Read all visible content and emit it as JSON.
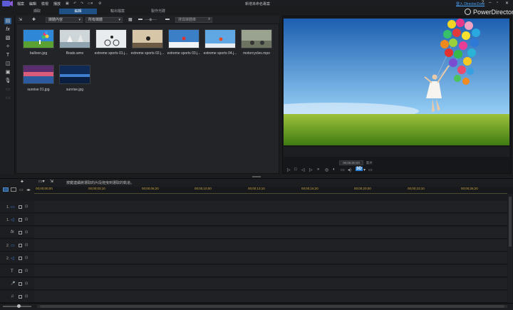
{
  "menu": [
    "檔案",
    "編輯",
    "檢視",
    "播放"
  ],
  "project_title": "新增未命名專案",
  "login_link": "登入 DirectorZone",
  "brand": "PowerDirector",
  "tabs": [
    {
      "label": "擷取"
    },
    {
      "label": "編輯"
    },
    {
      "label": "輸出檔案"
    },
    {
      "label": "製作光碟"
    }
  ],
  "library": {
    "filter1": "媒體內容",
    "filter2": "所有媒體",
    "search_placeholder": "搜尋媒體庫",
    "items": [
      {
        "label": "balloon.jpg"
      },
      {
        "label": "Boats.wmv"
      },
      {
        "label": "extreme sports 01.j..."
      },
      {
        "label": "extreme sports 02.j..."
      },
      {
        "label": "extreme sports 03.j..."
      },
      {
        "label": "extreme sports 04.j..."
      },
      {
        "label": "motorcycles.mpo"
      },
      {
        "label": "sunrise 01.jpg"
      },
      {
        "label": "sunrise.jpg"
      }
    ]
  },
  "preview": {
    "timecode": "00;00;00;00",
    "mode": "影片"
  },
  "timeline": {
    "hint": "按鍵連續將選取的片段拖曳到選取的軌道。",
    "ruler": [
      "00;00;00;00",
      "00;00;03;10",
      "00;00;06;20",
      "00;00;10;00",
      "00;00;13;10",
      "00;00;16;20",
      "00;00;20;00",
      "00;00;23;10",
      "00;00;26;20",
      "00;00;30;00",
      "00;00;33;10"
    ],
    "tracks": [
      {
        "num": "1.",
        "icon": "video-track-icon",
        "glyph": "▭"
      },
      {
        "num": "1.",
        "icon": "audio-track-icon",
        "glyph": "◁"
      },
      {
        "num": "",
        "icon": "fx-track-icon",
        "glyph": "fx"
      },
      {
        "num": "2.",
        "icon": "video-track-icon",
        "glyph": "▭"
      },
      {
        "num": "2.",
        "icon": "audio-track-icon",
        "glyph": "◁"
      },
      {
        "num": "",
        "icon": "title-track-icon",
        "glyph": "T"
      },
      {
        "num": "",
        "icon": "voice-track-icon",
        "glyph": "🎤"
      },
      {
        "num": "",
        "icon": "music-track-icon",
        "glyph": "♫"
      }
    ]
  },
  "colors": {
    "accent": "#2a7fd6",
    "ruler_text": "#c9a441"
  }
}
